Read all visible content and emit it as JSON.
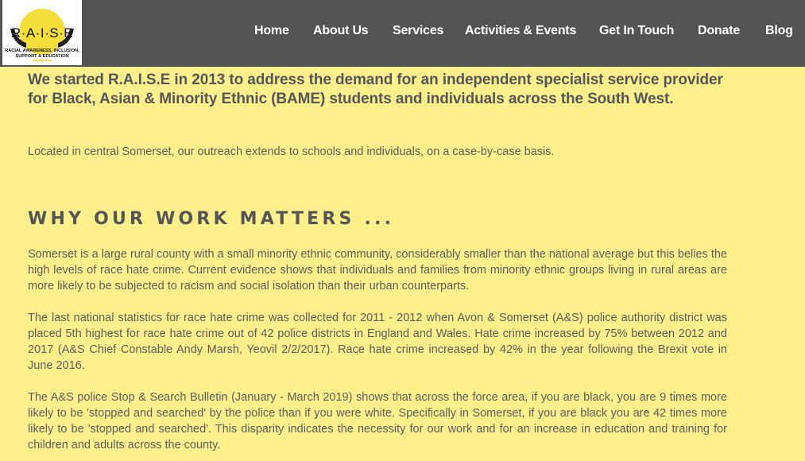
{
  "logo": {
    "title": "R·A·I·S·E",
    "tagline_1": "RACIAL AWARENESS, INCLUSION,",
    "tagline_2": "SUPPORT & EDUCATION"
  },
  "nav": {
    "items": [
      "Home",
      "About Us",
      "Services",
      "Activities & Events",
      "Get In Touch",
      "Donate",
      "Blog"
    ]
  },
  "main": {
    "intro": "We started R.A.I.S.E in 2013 to address the demand for an independent specialist service provider for Black, Asian & Minority Ethnic (BAME) students and individuals across the South West.",
    "located": "Located in central Somerset, our outreach extends to schools and individuals, on a case-by-case basis.",
    "section_title": "WHY OUR WORK MATTERS ...",
    "paragraphs": [
      "Somerset is a large rural county with a small minority ethnic community, considerably smaller than the national average but this belies the high levels of race hate crime. Current evidence shows that individuals and families from minority ethnic groups living in rural areas are more likely to be subjected to racism and social isolation than their urban counterparts.",
      "The last national statistics for race hate crime was collected for 2011 - 2012 when Avon & Somerset (A&S) police authority district was placed 5th highest for race hate crime out of 42 police districts in England and Wales. Hate crime increased by 75% between 2012 and 2017  (A&S Chief Constable Andy Marsh, Yeovil 2/2/2017). Race hate crime increased by 42% in the year following the Brexit vote in June 2016.",
      "The A&S police Stop & Search Bulletin (January - March 2019) shows that across the force area, if you are black, you are 9 times more likely to be 'stopped and searched' by the police than if you were white. Specifically in Somerset, if you are black you are 42 times more likely to be 'stopped and searched'. This disparity indicates the necessity for our work and for an increase in education and training for children and adults across the county."
    ]
  },
  "colors": {
    "background": "#FFF08C",
    "header": "#545454",
    "logo_yellow": "#F5DD3A",
    "text": "#5c5c5c",
    "heading": "#555555"
  },
  "icons": {
    "logo": "raise-logo-icon"
  }
}
